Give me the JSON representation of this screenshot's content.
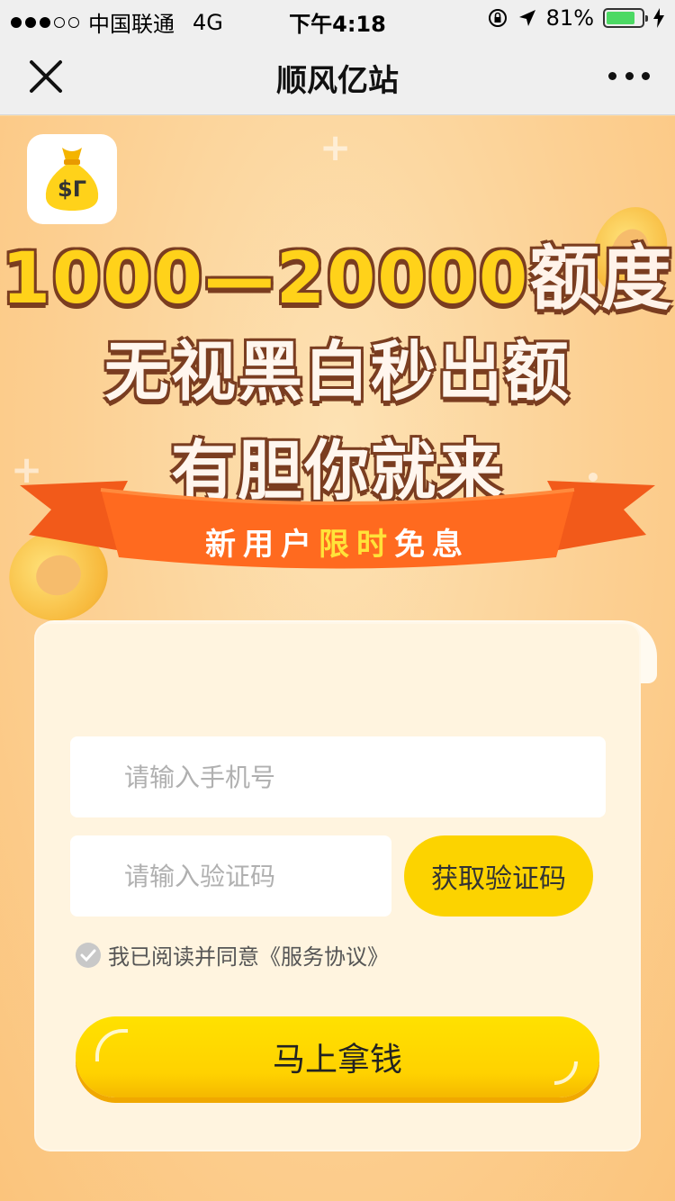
{
  "status_bar": {
    "carrier": "中国联通",
    "network": "4G",
    "time": "下午4:18",
    "battery": "81%",
    "battery_level": 0.81
  },
  "nav": {
    "title": "顺风亿站"
  },
  "logo": {
    "glyph": "$Γ"
  },
  "headline": {
    "line1_part1": "1000—20000",
    "line1_part2": "额度",
    "line2": "无视黑白秒出额",
    "line3": "有胆你就来"
  },
  "ribbon": {
    "part1": "新用户",
    "highlight": "限时",
    "part2": "免息"
  },
  "form": {
    "phone_placeholder": "请输入手机号",
    "code_placeholder": "请输入验证码",
    "get_code_label": "获取验证码",
    "agreement": "我已阅读并同意《服务协议》",
    "submit_label": "马上拿钱"
  },
  "colors": {
    "accent": "#fcd300",
    "ribbon": "#f25a1a",
    "background": "#fcd093"
  }
}
